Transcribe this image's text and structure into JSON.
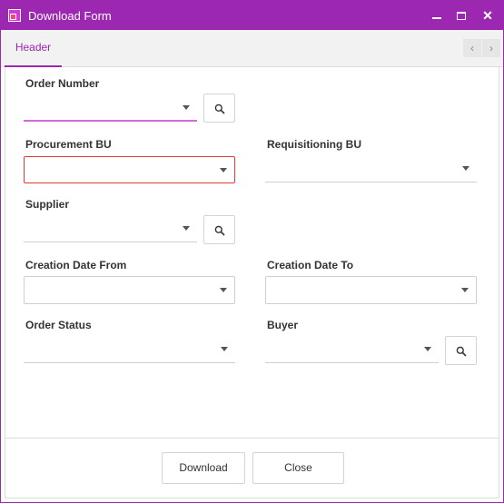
{
  "window": {
    "title": "Download Form",
    "accent_color": "#9c27b0",
    "controls": {
      "minimize_icon": "minimize-icon",
      "maximize_icon": "maximize-icon",
      "close_glyph": "✕"
    }
  },
  "tabs": {
    "items": [
      {
        "label": "Header",
        "active": true
      }
    ],
    "prev_glyph": "‹",
    "next_glyph": "›"
  },
  "form": {
    "order_number": {
      "label": "Order Number",
      "value": ""
    },
    "procurement_bu": {
      "label": "Procurement BU",
      "value": "",
      "state": "error",
      "error_color": "#e53935"
    },
    "requisitioning_bu": {
      "label": "Requisitioning BU",
      "value": ""
    },
    "supplier": {
      "label": "Supplier",
      "value": ""
    },
    "creation_date_from": {
      "label": "Creation Date From",
      "value": ""
    },
    "creation_date_to": {
      "label": "Creation Date To",
      "value": ""
    },
    "order_status": {
      "label": "Order Status",
      "value": ""
    },
    "buyer": {
      "label": "Buyer",
      "value": ""
    }
  },
  "footer": {
    "download_label": "Download",
    "close_label": "Close"
  }
}
